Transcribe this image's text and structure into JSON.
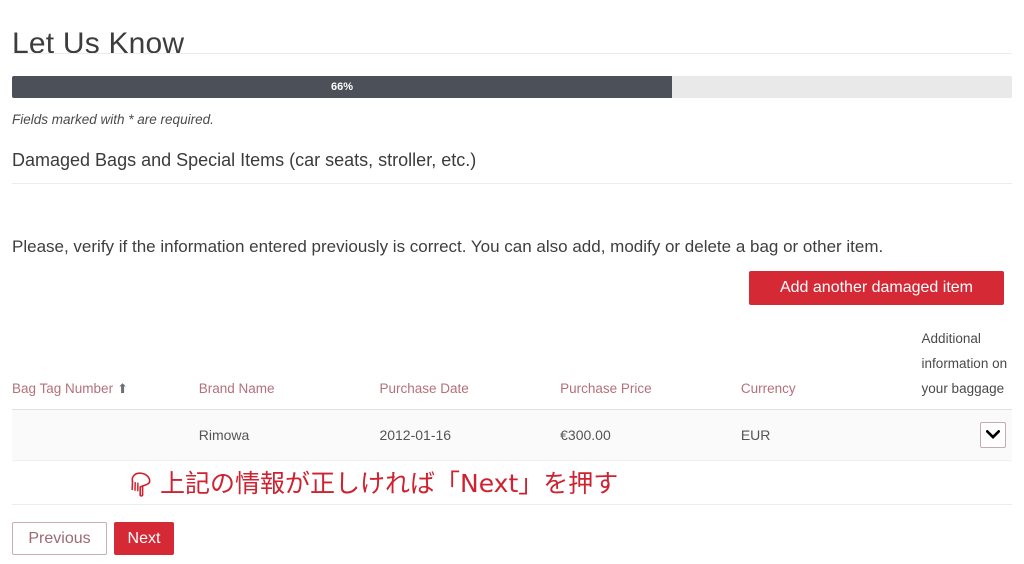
{
  "header": {
    "title": "Let Us Know"
  },
  "progress": {
    "percent_label": "66%",
    "percent_value": 66,
    "fill_color": "#4b5059",
    "track_color": "#e9e9e9"
  },
  "notes": {
    "required_fields": "Fields marked with * are required."
  },
  "section": {
    "heading": "Damaged Bags and Special Items (car seats, stroller, etc.)",
    "intro": "Please, verify if the information entered previously is correct. You can also add, modify or delete a bag or other item."
  },
  "actions": {
    "add_item_label": "Add another damaged item",
    "add_item_color": "#d62936"
  },
  "table": {
    "columns": [
      {
        "label": "Bag Tag Number",
        "sort_indicator": "⬆",
        "color": "#b5707a"
      },
      {
        "label": "Brand Name",
        "color": "#b5707a"
      },
      {
        "label": "Purchase Date",
        "color": "#b5707a"
      },
      {
        "label": "Purchase Price",
        "color": "#b5707a"
      },
      {
        "label": "Currency",
        "color": "#b5707a"
      },
      {
        "label": "Additional information on your baggage",
        "color": "#4a4a4a"
      }
    ],
    "rows": [
      {
        "bag_tag_number": "",
        "brand_name": "Rimowa",
        "purchase_date": "2012-01-16",
        "purchase_price": "€300.00",
        "currency": "EUR",
        "additional_information": "",
        "expand_icon": "chevron-down-icon"
      }
    ]
  },
  "annotation": {
    "icon": "pointing-hand-icon",
    "text": "上記の情報が正しければ「Next」を押す",
    "color": "#cf2230"
  },
  "footer": {
    "previous_label": "Previous",
    "next_label": "Next",
    "next_color": "#d62936"
  }
}
